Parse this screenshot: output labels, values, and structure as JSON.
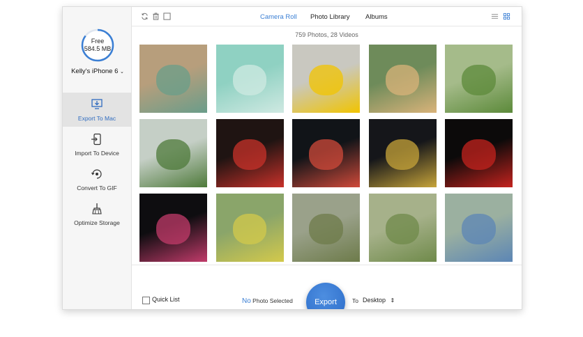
{
  "sidebar": {
    "storage_label": "Free",
    "storage_value": "584.5 MB",
    "device_name": "Kelly's iPhone 6",
    "items": [
      {
        "label": "Export To Mac"
      },
      {
        "label": "Import To Device"
      },
      {
        "label": "Convert To GIF"
      },
      {
        "label": "Optimize Storage"
      }
    ]
  },
  "tabs": [
    "Camera Roll",
    "Photo Library",
    "Albums"
  ],
  "photo_count": "759 Photos, 28 Videos",
  "bottom": {
    "quick_list": "Quick List",
    "no": "No",
    "photo_selected": "Photo Selected",
    "export": "Export",
    "to": "To",
    "destination": "Desktop"
  },
  "colors": {
    "accent": "#3b7fd4",
    "export_button": "#2f6fcc"
  },
  "photos": [
    {
      "name": "collage-wall",
      "bg": "#b79e7c",
      "fg": "#6a9d8a"
    },
    {
      "name": "green-car",
      "bg": "#8fd1c2",
      "fg": "#cfe9e2"
    },
    {
      "name": "yellow-flowers",
      "bg": "#c9c8c0",
      "fg": "#f1c400"
    },
    {
      "name": "succulents",
      "bg": "#6e8b5a",
      "fg": "#d9b37a"
    },
    {
      "name": "potted-plant",
      "bg": "#a5bb8a",
      "fg": "#5c8a3a"
    },
    {
      "name": "glass-terrarium",
      "bg": "#c5cfc6",
      "fg": "#4e7a3a"
    },
    {
      "name": "red-lanterns-night",
      "bg": "#1f1412",
      "fg": "#c8312a"
    },
    {
      "name": "lantern-festival-1",
      "bg": "#111418",
      "fg": "#d04a3a"
    },
    {
      "name": "lantern-festival-2",
      "bg": "#15161a",
      "fg": "#c7a43a"
    },
    {
      "name": "red-lanterns-dark",
      "bg": "#0c0a0a",
      "fg": "#c4231e"
    },
    {
      "name": "lantern-figure",
      "bg": "#0e0d10",
      "fg": "#c13b6a"
    },
    {
      "name": "village-field",
      "bg": "#8aa56a",
      "fg": "#d3c94b"
    },
    {
      "name": "village-houses",
      "bg": "#9aa18a",
      "fg": "#6d7b4a"
    },
    {
      "name": "rural-scene",
      "bg": "#a6b18a",
      "fg": "#6f8a4a"
    },
    {
      "name": "cartoon-statue",
      "bg": "#9bb0a0",
      "fg": "#5c86b5"
    }
  ]
}
